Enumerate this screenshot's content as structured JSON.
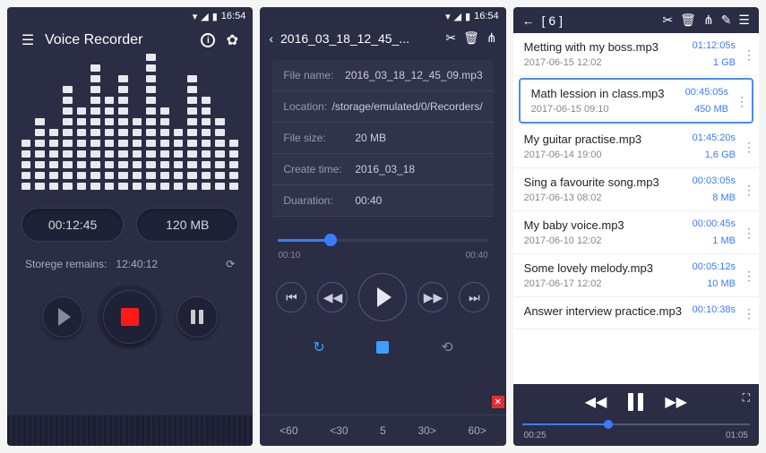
{
  "status": {
    "time": "16:54"
  },
  "screen1": {
    "title": "Voice Recorder",
    "elapsed": "00:12:45",
    "size": "120 MB",
    "storage_label": "Storege remains:",
    "storage_value": "12:40:12",
    "eq_heights": [
      5,
      7,
      6,
      10,
      8,
      12,
      9,
      11,
      7,
      13,
      8,
      6,
      11,
      9,
      7,
      5
    ]
  },
  "screen2": {
    "crumb": "2016_03_18_12_45_...",
    "info": [
      {
        "k": "File name:",
        "v": "2016_03_18_12_45_09.mp3"
      },
      {
        "k": "Location:",
        "v": "/storage/emulated/0/Recorders/"
      },
      {
        "k": "File size:",
        "v": "20 MB"
      },
      {
        "k": "Create time:",
        "v": "2016_03_18"
      },
      {
        "k": "Duaration:",
        "v": "00:40"
      }
    ],
    "pos": "00:10",
    "dur": "00:40",
    "progress_pct": 25,
    "seek": [
      "<60",
      "<30",
      "5",
      "30>",
      "60>"
    ]
  },
  "screen3": {
    "count_label": "[ 6 ]",
    "items": [
      {
        "title": "Metting with my boss.mp3",
        "dur": "01:12:05s",
        "date": "2017-06-15   12:02",
        "size": "1 GB",
        "sel": false
      },
      {
        "title": "Math lession in class.mp3",
        "dur": "00:45:05s",
        "date": "2017-06-15   09:10",
        "size": "450 MB",
        "sel": true
      },
      {
        "title": "My guitar practise.mp3",
        "dur": "01:45:20s",
        "date": "2017-06-14   19:00",
        "size": "1,6 GB",
        "sel": false
      },
      {
        "title": "Sing a favourite song.mp3",
        "dur": "00:03:05s",
        "date": "2017-06-13   08:02",
        "size": "8 MB",
        "sel": false
      },
      {
        "title": "My baby voice.mp3",
        "dur": "00:00:45s",
        "date": "2017-06-10   12:02",
        "size": "1 MB",
        "sel": false
      },
      {
        "title": "Some lovely melody.mp3",
        "dur": "00:05:12s",
        "date": "2017-06-17   12:02",
        "size": "10 MB",
        "sel": false
      },
      {
        "title": "Answer interview practice.mp3",
        "dur": "00:10:38s",
        "date": "",
        "size": "",
        "sel": false
      }
    ],
    "player": {
      "pos": "00:25",
      "dur": "01:05",
      "progress_pct": 38
    }
  }
}
